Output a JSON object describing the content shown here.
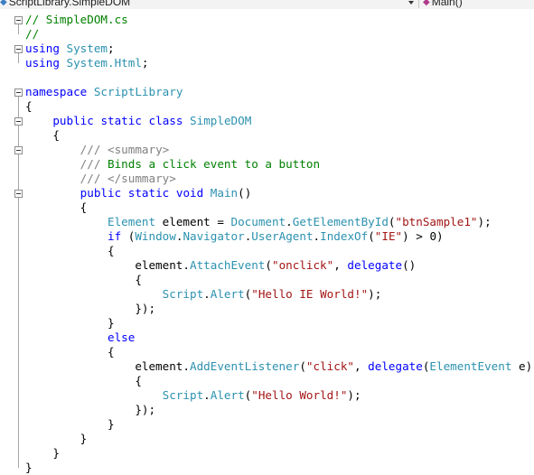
{
  "navbar": {
    "type_selector": {
      "icon": "class-icon",
      "value": "ScriptLibrary.SimpleDOM"
    },
    "member_selector": {
      "icon": "method-icon",
      "value": "Main()"
    }
  },
  "editor": {
    "file_name": "SimpleDOM.cs",
    "language": "C#",
    "colors": {
      "keyword": "#0000ff",
      "type": "#2b91af",
      "string": "#a31515",
      "comment": "#008000",
      "doc_tag": "#808080"
    },
    "lines": [
      {
        "collapse": true,
        "tokens": [
          {
            "k": "com",
            "t": "// SimpleDOM.cs"
          }
        ]
      },
      {
        "tokens": [
          {
            "k": "com",
            "t": "//"
          }
        ]
      },
      {
        "collapse": true,
        "tokens": [
          {
            "k": "kw",
            "t": "using"
          },
          {
            "k": "plain",
            "t": " "
          },
          {
            "k": "type",
            "t": "System"
          },
          {
            "k": "plain",
            "t": ";"
          }
        ]
      },
      {
        "tokens": [
          {
            "k": "kw",
            "t": "using"
          },
          {
            "k": "plain",
            "t": " "
          },
          {
            "k": "type",
            "t": "System.Html"
          },
          {
            "k": "plain",
            "t": ";"
          }
        ]
      },
      {
        "tokens": []
      },
      {
        "collapse": true,
        "tokens": [
          {
            "k": "kw",
            "t": "namespace"
          },
          {
            "k": "plain",
            "t": " "
          },
          {
            "k": "type",
            "t": "ScriptLibrary"
          }
        ]
      },
      {
        "tokens": [
          {
            "k": "plain",
            "t": "{"
          }
        ]
      },
      {
        "collapse": true,
        "tokens": [
          {
            "k": "plain",
            "t": "    "
          },
          {
            "k": "kw",
            "t": "public"
          },
          {
            "k": "plain",
            "t": " "
          },
          {
            "k": "kw",
            "t": "static"
          },
          {
            "k": "plain",
            "t": " "
          },
          {
            "k": "kw",
            "t": "class"
          },
          {
            "k": "plain",
            "t": " "
          },
          {
            "k": "type",
            "t": "SimpleDOM"
          }
        ]
      },
      {
        "tokens": [
          {
            "k": "plain",
            "t": "    {"
          }
        ]
      },
      {
        "collapse": true,
        "tokens": [
          {
            "k": "plain",
            "t": "        "
          },
          {
            "k": "doc",
            "t": "/// <summary>"
          }
        ]
      },
      {
        "tokens": [
          {
            "k": "plain",
            "t": "        "
          },
          {
            "k": "doc",
            "t": "///"
          },
          {
            "k": "com",
            "t": " Binds a click event to a button"
          }
        ]
      },
      {
        "tokens": [
          {
            "k": "plain",
            "t": "        "
          },
          {
            "k": "doc",
            "t": "/// </summary>"
          }
        ]
      },
      {
        "collapse": true,
        "tokens": [
          {
            "k": "plain",
            "t": "        "
          },
          {
            "k": "kw",
            "t": "public"
          },
          {
            "k": "plain",
            "t": " "
          },
          {
            "k": "kw",
            "t": "static"
          },
          {
            "k": "plain",
            "t": " "
          },
          {
            "k": "kw",
            "t": "void"
          },
          {
            "k": "plain",
            "t": " "
          },
          {
            "k": "type",
            "t": "Main"
          },
          {
            "k": "plain",
            "t": "()"
          }
        ]
      },
      {
        "tokens": [
          {
            "k": "plain",
            "t": "        {"
          }
        ]
      },
      {
        "tokens": [
          {
            "k": "plain",
            "t": "            "
          },
          {
            "k": "type",
            "t": "Element"
          },
          {
            "k": "plain",
            "t": " element = "
          },
          {
            "k": "type",
            "t": "Document"
          },
          {
            "k": "plain",
            "t": "."
          },
          {
            "k": "type",
            "t": "GetElementById"
          },
          {
            "k": "plain",
            "t": "("
          },
          {
            "k": "str",
            "t": "\"btnSample1\""
          },
          {
            "k": "plain",
            "t": ");"
          }
        ]
      },
      {
        "tokens": [
          {
            "k": "plain",
            "t": "            "
          },
          {
            "k": "kw",
            "t": "if"
          },
          {
            "k": "plain",
            "t": " ("
          },
          {
            "k": "type",
            "t": "Window"
          },
          {
            "k": "plain",
            "t": "."
          },
          {
            "k": "type",
            "t": "Navigator"
          },
          {
            "k": "plain",
            "t": "."
          },
          {
            "k": "type",
            "t": "UserAgent"
          },
          {
            "k": "plain",
            "t": "."
          },
          {
            "k": "type",
            "t": "IndexOf"
          },
          {
            "k": "plain",
            "t": "("
          },
          {
            "k": "str",
            "t": "\"IE\""
          },
          {
            "k": "plain",
            "t": ") > 0)"
          }
        ]
      },
      {
        "tokens": [
          {
            "k": "plain",
            "t": "            {"
          }
        ]
      },
      {
        "tokens": [
          {
            "k": "plain",
            "t": "                element."
          },
          {
            "k": "type",
            "t": "AttachEvent"
          },
          {
            "k": "plain",
            "t": "("
          },
          {
            "k": "str",
            "t": "\"onclick\""
          },
          {
            "k": "plain",
            "t": ", "
          },
          {
            "k": "kw",
            "t": "delegate"
          },
          {
            "k": "plain",
            "t": "()"
          }
        ]
      },
      {
        "tokens": [
          {
            "k": "plain",
            "t": "                {"
          }
        ]
      },
      {
        "tokens": [
          {
            "k": "plain",
            "t": "                    "
          },
          {
            "k": "type",
            "t": "Script"
          },
          {
            "k": "plain",
            "t": "."
          },
          {
            "k": "type",
            "t": "Alert"
          },
          {
            "k": "plain",
            "t": "("
          },
          {
            "k": "str",
            "t": "\"Hello IE World!\""
          },
          {
            "k": "plain",
            "t": ");"
          }
        ]
      },
      {
        "tokens": [
          {
            "k": "plain",
            "t": "                });"
          }
        ]
      },
      {
        "tokens": [
          {
            "k": "plain",
            "t": "            }"
          }
        ]
      },
      {
        "tokens": [
          {
            "k": "plain",
            "t": "            "
          },
          {
            "k": "kw",
            "t": "else"
          }
        ]
      },
      {
        "tokens": [
          {
            "k": "plain",
            "t": "            {"
          }
        ]
      },
      {
        "tokens": [
          {
            "k": "plain",
            "t": "                element."
          },
          {
            "k": "type",
            "t": "AddEventListener"
          },
          {
            "k": "plain",
            "t": "("
          },
          {
            "k": "str",
            "t": "\"click\""
          },
          {
            "k": "plain",
            "t": ", "
          },
          {
            "k": "kw",
            "t": "delegate"
          },
          {
            "k": "plain",
            "t": "("
          },
          {
            "k": "type",
            "t": "ElementEvent"
          },
          {
            "k": "plain",
            "t": " e)"
          }
        ]
      },
      {
        "tokens": [
          {
            "k": "plain",
            "t": "                {"
          }
        ]
      },
      {
        "tokens": [
          {
            "k": "plain",
            "t": "                    "
          },
          {
            "k": "type",
            "t": "Script"
          },
          {
            "k": "plain",
            "t": "."
          },
          {
            "k": "type",
            "t": "Alert"
          },
          {
            "k": "plain",
            "t": "("
          },
          {
            "k": "str",
            "t": "\"Hello World!\""
          },
          {
            "k": "plain",
            "t": ");"
          }
        ]
      },
      {
        "tokens": [
          {
            "k": "plain",
            "t": "                });"
          }
        ]
      },
      {
        "tokens": [
          {
            "k": "plain",
            "t": "            }"
          }
        ]
      },
      {
        "tokens": [
          {
            "k": "plain",
            "t": "        }"
          }
        ]
      },
      {
        "tokens": [
          {
            "k": "plain",
            "t": "    }"
          }
        ]
      },
      {
        "tokens": [
          {
            "k": "plain",
            "t": "}"
          }
        ]
      }
    ]
  }
}
